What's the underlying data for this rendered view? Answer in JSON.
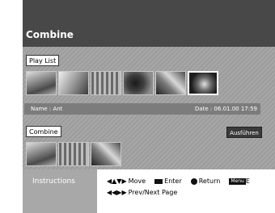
{
  "header": {
    "title": "Combine"
  },
  "playlist": {
    "label": "Play List",
    "thumbnails": [
      "thumb-1",
      "thumb-2",
      "thumb-3",
      "thumb-4",
      "thumb-5",
      "thumb-6"
    ],
    "selected_index": 5,
    "info": {
      "name": "Name : Ant",
      "date": "Date : 06.01.00  17:59"
    }
  },
  "combine": {
    "label": "Combine",
    "execute_label": "Ausführen",
    "thumbnails": [
      "combine-thumb-1",
      "combine-thumb-2",
      "combine-thumb-3"
    ]
  },
  "instructions": {
    "label": "Instructions",
    "move": "Move",
    "enter": "Enter",
    "return": "Return",
    "menu_icon": "Menu",
    "menu_exit": "E",
    "page": "Prev/Next Page"
  }
}
